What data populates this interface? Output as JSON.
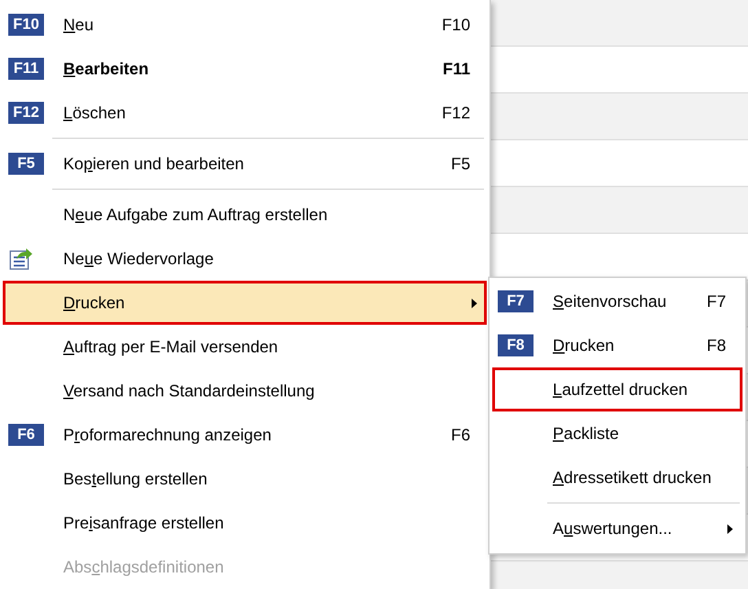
{
  "context_menu": {
    "items": [
      {
        "kind": "item",
        "badge": "F10",
        "label": {
          "key": "N",
          "after": "eu"
        },
        "shortcut": "F10",
        "bold": false,
        "disabled": false,
        "selected": false,
        "outlined": false,
        "submenu": false
      },
      {
        "kind": "item",
        "badge": "F11",
        "label": {
          "key": "B",
          "after": "earbeiten"
        },
        "shortcut": "F11",
        "bold": true,
        "disabled": false,
        "selected": false,
        "outlined": false,
        "submenu": false
      },
      {
        "kind": "item",
        "badge": "F12",
        "label": {
          "key": "L",
          "after": "öschen"
        },
        "shortcut": "F12",
        "bold": false,
        "disabled": false,
        "selected": false,
        "outlined": false,
        "submenu": false
      },
      {
        "kind": "separator"
      },
      {
        "kind": "item",
        "badge": "F5",
        "label": {
          "before": "Ko",
          "key": "p",
          "after": "ieren und bearbeiten"
        },
        "shortcut": "F5",
        "bold": false,
        "disabled": false,
        "selected": false,
        "outlined": false,
        "submenu": false
      },
      {
        "kind": "separator"
      },
      {
        "kind": "item",
        "label": {
          "before": "N",
          "key": "e",
          "after": "ue Aufgabe zum Auftrag erstellen"
        },
        "bold": false,
        "disabled": false,
        "selected": false,
        "outlined": false,
        "submenu": false
      },
      {
        "kind": "icon_item",
        "label": {
          "before": "Ne",
          "key": "u",
          "after": "e Wiedervorlage"
        },
        "bold": false,
        "disabled": false,
        "selected": false,
        "outlined": false,
        "submenu": false
      },
      {
        "kind": "item",
        "label": {
          "key": "D",
          "after": "rucken"
        },
        "bold": false,
        "disabled": false,
        "selected": true,
        "outlined": true,
        "submenu": true
      },
      {
        "kind": "item",
        "label": {
          "key": "A",
          "after": "uftrag per E-Mail versenden"
        },
        "bold": false,
        "disabled": false,
        "selected": false,
        "outlined": false,
        "submenu": false
      },
      {
        "kind": "item",
        "label": {
          "key": "V",
          "after": "ersand nach Standardeinstellung"
        },
        "bold": false,
        "disabled": false,
        "selected": false,
        "outlined": false,
        "submenu": false
      },
      {
        "kind": "item",
        "badge": "F6",
        "label": {
          "before": "P",
          "key": "r",
          "after": "oformarechnung anzeigen"
        },
        "shortcut": "F6",
        "bold": false,
        "disabled": false,
        "selected": false,
        "outlined": false,
        "submenu": false
      },
      {
        "kind": "item",
        "label": {
          "before": "Bes",
          "key": "t",
          "after": "ellung erstellen"
        },
        "bold": false,
        "disabled": false,
        "selected": false,
        "outlined": false,
        "submenu": false
      },
      {
        "kind": "item",
        "label": {
          "before": "Pre",
          "key": "i",
          "after": "sanfrage erstellen"
        },
        "bold": false,
        "disabled": false,
        "selected": false,
        "outlined": false,
        "submenu": false
      },
      {
        "kind": "item",
        "label": {
          "before": "Abs",
          "key": "c",
          "after": "hlagsdefinitionen"
        },
        "bold": false,
        "disabled": true,
        "selected": false,
        "outlined": false,
        "submenu": false
      }
    ]
  },
  "submenu": {
    "items": [
      {
        "kind": "item",
        "badge": "F7",
        "label": {
          "key": "S",
          "after": "eitenvorschau"
        },
        "shortcut": "F7",
        "bold": false,
        "disabled": false,
        "selected": false,
        "outlined": false,
        "submenu": false
      },
      {
        "kind": "item",
        "badge": "F8",
        "label": {
          "key": "D",
          "after": "rucken"
        },
        "shortcut": "F8",
        "bold": false,
        "disabled": false,
        "selected": false,
        "outlined": false,
        "submenu": false
      },
      {
        "kind": "item",
        "label": {
          "key": "L",
          "after": "aufzettel drucken"
        },
        "bold": false,
        "disabled": false,
        "selected": false,
        "outlined": true,
        "submenu": false
      },
      {
        "kind": "item",
        "label": {
          "key": "P",
          "after": "ackliste"
        },
        "bold": false,
        "disabled": false,
        "selected": false,
        "outlined": false,
        "submenu": false
      },
      {
        "kind": "item",
        "label": {
          "key": "A",
          "after": "dressetikett drucken"
        },
        "bold": false,
        "disabled": false,
        "selected": false,
        "outlined": false,
        "submenu": false
      },
      {
        "kind": "separator"
      },
      {
        "kind": "item",
        "label": {
          "before": "A",
          "key": "u",
          "after": "swertungen..."
        },
        "bold": false,
        "disabled": false,
        "selected": false,
        "outlined": false,
        "submenu": true
      }
    ]
  }
}
